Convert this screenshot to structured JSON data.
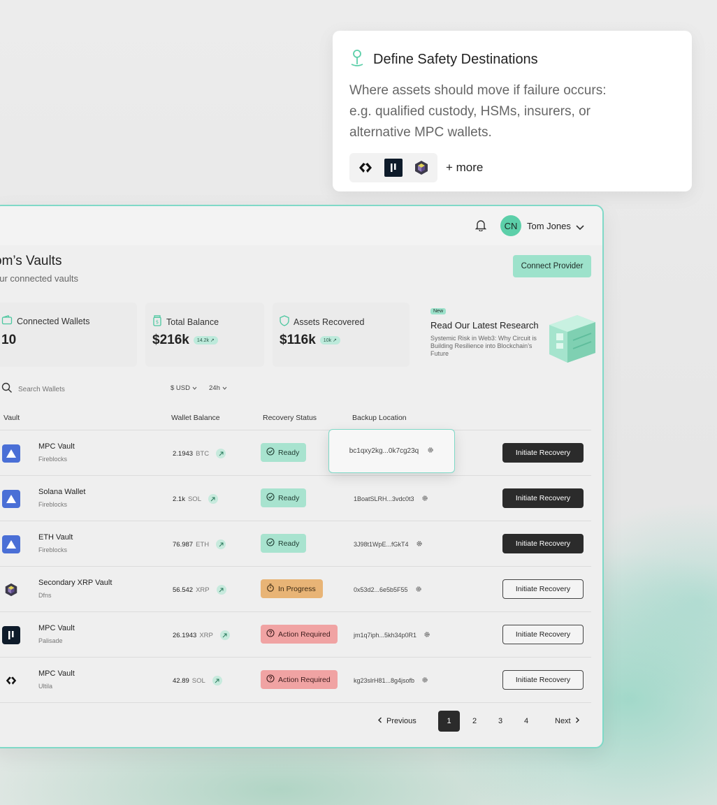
{
  "tooltip": {
    "title": "Define Safety Destinations",
    "body": "Where assets should move if failure occurs: e.g. qualified custody, HSMs, insurers, or alternative MPC wallets.",
    "more": "+ more",
    "logos": [
      "ultila-logo",
      "palisade-logo",
      "dfns-logo"
    ]
  },
  "header": {
    "user_initials": "CN",
    "user_name": "Tom Jones"
  },
  "page": {
    "title": "om’s Vaults",
    "subtitle": "our connected vaults",
    "connect_label": "Connect Provider"
  },
  "stats": [
    {
      "label": "Connected Wallets",
      "value": "10",
      "badge": ""
    },
    {
      "label": "Total Balance",
      "value": "$216k",
      "badge": "14.2k ↗"
    },
    {
      "label": "Assets Recovered",
      "value": "$116k",
      "badge": "10k ↗"
    }
  ],
  "research": {
    "badge": "New",
    "title": "Read Our Latest Research",
    "desc": "Systemic Risk in Web3: Why Circuit is Building Resilience into Blockchain’s Future"
  },
  "filters": {
    "search_placeholder": "Search Wallets",
    "currency": "$ USD",
    "period": "24h"
  },
  "table": {
    "headers": [
      "Vault",
      "Wallet Balance",
      "Recovery Status",
      "Backup Location"
    ],
    "rows": [
      {
        "name": "MPC Vault",
        "provider": "Fireblocks",
        "amount": "2.1943",
        "unit": "BTC",
        "status": "Ready",
        "backup": "bc1qxy2kg...0k7cg23q",
        "action": "Initiate Recovery"
      },
      {
        "name": "Solana Wallet",
        "provider": "Fireblocks",
        "amount": "2.1k",
        "unit": "SOL",
        "status": "Ready",
        "backup": "1BoatSLRH...3vdc0t3",
        "action": "Initiate Recovery"
      },
      {
        "name": "ETH Vault",
        "provider": "Fireblocks",
        "amount": "76.987",
        "unit": "ETH",
        "status": "Ready",
        "backup": "3J98t1WpE...fGkT4",
        "action": "Initiate Recovery"
      },
      {
        "name": "Secondary XRP Vault",
        "provider": "Dfns",
        "amount": "56.542",
        "unit": "XRP",
        "status": "In Progress",
        "backup": "0x53d2...6e5b5F55",
        "action": "Initiate Recovery"
      },
      {
        "name": "MPC Vault",
        "provider": "Palisade",
        "amount": "26.1943",
        "unit": "XRP",
        "status": "Action Required",
        "backup": "jm1q7iph...5kh34p0R1",
        "action": "Initiate Recovery"
      },
      {
        "name": "MPC Vault",
        "provider": "Ultila",
        "amount": "42.89",
        "unit": "SOL",
        "status": "Action Required",
        "backup": "kg23slrH81...8g4jsofb",
        "action": "Initiate Recovery"
      }
    ]
  },
  "pagination": {
    "previous": "Previous",
    "pages": [
      "1",
      "2",
      "3",
      "4"
    ],
    "current": "1",
    "next": "Next"
  },
  "colors": {
    "accent": "#7fd9c7",
    "ready": "#a8e3cf",
    "in_progress": "#e8b476",
    "action_required": "#f0a3a3",
    "dark_button": "#2b2b2b"
  }
}
